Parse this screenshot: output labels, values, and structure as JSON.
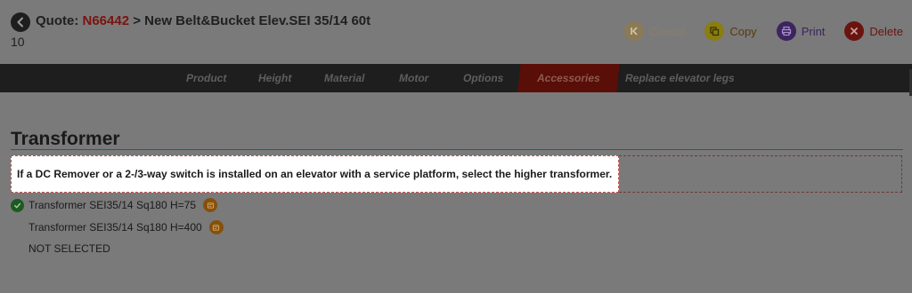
{
  "header": {
    "quote_prefix": "Quote: ",
    "quote_number": "N66442",
    "quote_suffix": " > New Belt&Bucket Elev.SEI 35/14 60t",
    "subline": "10"
  },
  "actions": {
    "cancel": "Cancel",
    "copy": "Copy",
    "print": "Print",
    "delete": "Delete"
  },
  "nav": {
    "tabs": [
      "Product",
      "Height",
      "Material",
      "Motor",
      "Options",
      "Accessories",
      "Replace elevator legs"
    ],
    "active": "Accessories"
  },
  "section": {
    "title": "Transformer",
    "notice": "If a DC Remover or a 2-/3-way switch is installed on an elevator with a service platform, select the higher transformer."
  },
  "options": [
    {
      "label": "Transformer SEI35/14 Sq180 H=75",
      "selected": true,
      "icon": "info-icon"
    },
    {
      "label": "Transformer SEI35/14 Sq180 H=400",
      "selected": false,
      "icon": "info-icon"
    },
    {
      "label": "NOT SELECTED",
      "selected": false
    }
  ],
  "colors": {
    "accent": "#c8200f",
    "nav_bg": "#1e1e1e",
    "overlay": "#7a7a7a"
  }
}
